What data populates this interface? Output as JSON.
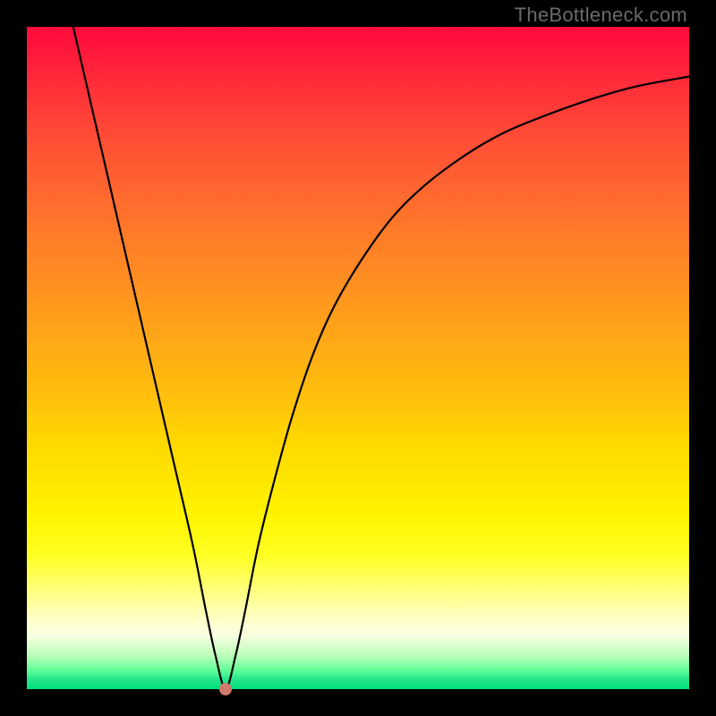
{
  "watermark": "TheBottleneck.com",
  "colors": {
    "frame": "#000000",
    "top": "#ff0a3d",
    "bottom": "#00e07d",
    "curve": "#000000",
    "dot": "#cf7a6a"
  },
  "chart_data": {
    "type": "line",
    "title": "",
    "subtitle": "",
    "xlabel": "",
    "ylabel": "",
    "xlim": [
      0,
      100
    ],
    "ylim": [
      0,
      100
    ],
    "grid": false,
    "legend": false,
    "annotations": [],
    "min_point": {
      "x": 30,
      "y": 0
    },
    "series": [
      {
        "name": "curve",
        "x": [
          7,
          10,
          13,
          16,
          19,
          22,
          25,
          27,
          28.5,
          30,
          31.5,
          33,
          35,
          37.5,
          40,
          43,
          46,
          50,
          55,
          60,
          66,
          72,
          78,
          85,
          92,
          100
        ],
        "y": [
          100,
          87,
          74,
          61,
          48,
          35,
          22,
          12,
          5,
          0,
          5,
          12,
          22,
          32,
          41,
          50,
          57,
          64,
          71,
          76,
          80.5,
          84,
          86.5,
          89,
          91,
          92.5
        ]
      }
    ]
  }
}
